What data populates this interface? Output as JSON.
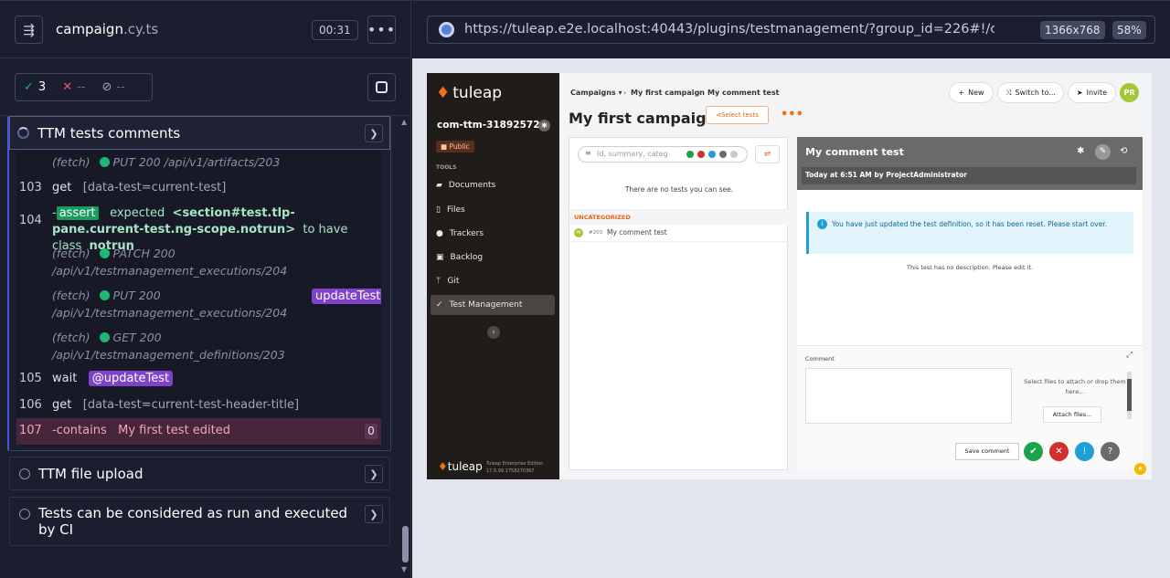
{
  "header": {
    "spec_name": "campaign",
    "spec_ext": ".cy.ts",
    "timer": "00:31"
  },
  "stats": {
    "passed": "3",
    "failed": "--",
    "pending": "--"
  },
  "active_test": {
    "title": "TTM tests comments"
  },
  "commands": {
    "fetch0": {
      "label": "(fetch)",
      "status": "PUT 200 /api/v1/artifacts/203"
    },
    "c103": {
      "num": "103",
      "name": "get",
      "arg": "[data-test=current-test]"
    },
    "c104": {
      "num": "104",
      "prefix": "-",
      "badge": "assert",
      "text1": "expected",
      "selector": "<section#test.tlp-pane.current-test.ng-scope.notrun>",
      "text2": "to have class",
      "cls": "notrun"
    },
    "fetch1": {
      "label": "(fetch)",
      "method": "PATCH 200",
      "path": "/api/v1/testmanagement_executions/204"
    },
    "fetch2": {
      "label": "(fetch)",
      "method": "PUT 200",
      "path": "/api/v1/testmanagement_executions/204",
      "alias": "updateTest"
    },
    "fetch3": {
      "label": "(fetch)",
      "method": "GET 200",
      "path": "/api/v1/testmanagement_definitions/203"
    },
    "c105": {
      "num": "105",
      "name": "wait",
      "alias": "@updateTest"
    },
    "c106": {
      "num": "106",
      "name": "get",
      "arg": "[data-test=current-test-header-title]"
    },
    "c107": {
      "num": "107",
      "name": "-contains",
      "arg": "My first test edited",
      "count": "0"
    }
  },
  "tests": [
    {
      "title": "TTM file upload"
    },
    {
      "title": "Tests can be considered as run and executed by CI"
    }
  ],
  "browser": {
    "url": "https://tuleap.e2e.localhost:40443/plugins/testmanagement/?group_id=226#!/campaigns/",
    "size": "1366x768",
    "zoom": "58%"
  },
  "app": {
    "logo": "tuleap",
    "project": "com-ttm-31892572",
    "public_badge": "Public",
    "tools_label": "TOOLS",
    "nav": [
      "Documents",
      "Files",
      "Trackers",
      "Backlog",
      "Git",
      "Test Management"
    ],
    "footer_logo": "tuleap",
    "footer_edition": "Tuleap Enterprise Edition",
    "footer_version": "17.5.99.1758270367",
    "breadcrumb": [
      "Campaigns",
      "My first campaign",
      "My comment test"
    ],
    "buttons": {
      "new": "New",
      "switch": "Switch to...",
      "invite": "Invite",
      "avatar": "PR"
    },
    "campaign_title": "My first campaign",
    "select_tests": "Select tests",
    "search_placeholder": "Id, summary, categ",
    "no_tests": "There are no tests you can see.",
    "category": "UNCATEGORIZED",
    "test_item": {
      "avatar": "PR",
      "id": "#203",
      "title": "My comment test"
    },
    "detail": {
      "title": "My comment test",
      "meta": "Today at 6:51 AM by ProjectAdministrator",
      "info": "You have just updated the test definition, so it has been reset. Please start over.",
      "no_desc": "This test has no description. Please edit it.",
      "comment_label": "Comment",
      "drop": "Select files to attach or drop them here...",
      "attach": "Attach files...",
      "save": "Save comment"
    },
    "colors": {
      "sidebar": "#201c1a",
      "accent": "#f06f1a",
      "pass": "#1aa34a",
      "fail": "#d32f2f",
      "info": "#1fa0d8",
      "skip": "#6a6a6a"
    }
  }
}
